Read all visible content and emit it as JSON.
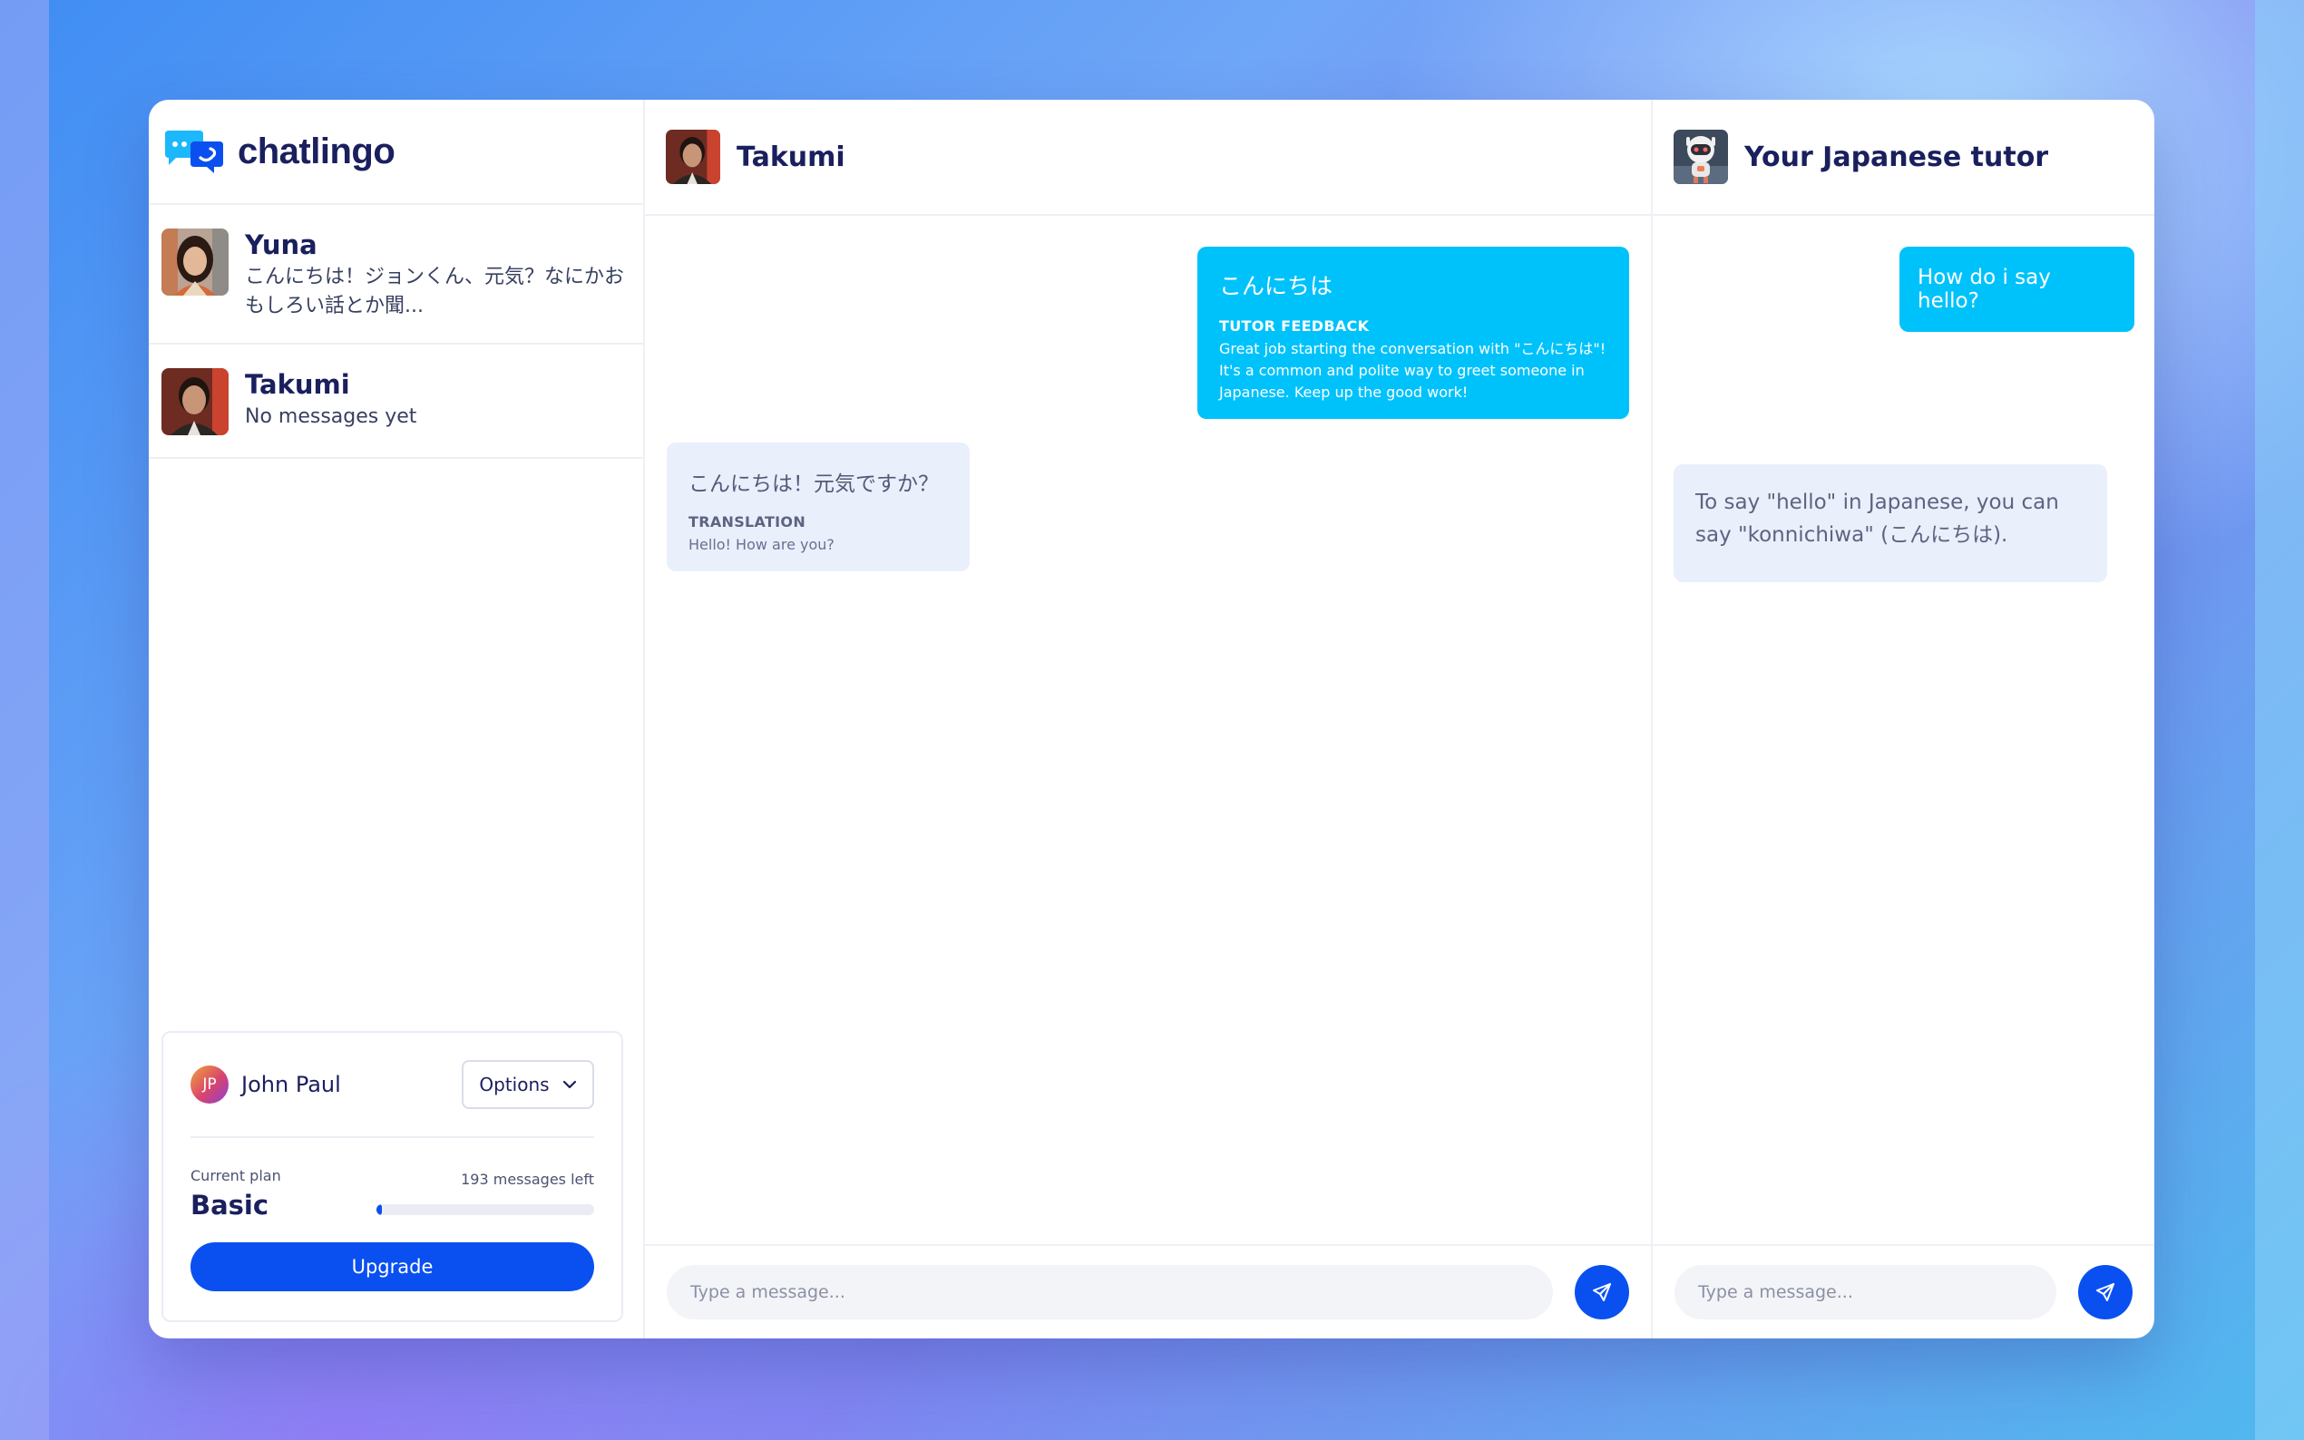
{
  "app": {
    "name": "chatlingo"
  },
  "contacts": [
    {
      "name": "Yuna",
      "preview": "こんにちは！ジョンくん、元気？なにかおもしろい話とか聞..."
    },
    {
      "name": "Takumi",
      "preview": "No messages yet"
    }
  ],
  "account": {
    "initials": "JP",
    "user_name": "John Paul",
    "options_label": "Options",
    "plan_label": "Current plan",
    "plan_name": "Basic",
    "messages_left": "193 messages left",
    "usage_fraction": 0.02,
    "upgrade_label": "Upgrade"
  },
  "chat": {
    "title": "Takumi",
    "messages": [
      {
        "text": "こんにちは",
        "feedback_label": "TUTOR FEEDBACK",
        "feedback_text": "Great job starting the conversation with \"こんにちは\"! It's a common and polite way to greet someone in Japanese. Keep up the good work!"
      },
      {
        "text": "こんにちは！元気ですか？",
        "translation_label": "TRANSLATION",
        "translation_text": "Hello! How are you?"
      }
    ],
    "input_placeholder": "Type a message..."
  },
  "tutor": {
    "title": "Your Japanese tutor",
    "messages": [
      {
        "text": "How do i say hello?"
      },
      {
        "text": "To say \"hello\" in Japanese, you can say \"konnichiwa\" (こんにちは)."
      }
    ],
    "input_placeholder": "Type a message..."
  },
  "colors": {
    "primary": "#0a50f0",
    "outgoing_bubble": "#00c2fb",
    "incoming_bubble": "#eaeffc",
    "heading": "#1a1f5e"
  },
  "icons": {
    "logo": "chat-bubbles-logo-icon",
    "dropdown": "chevron-down-icon",
    "send": "send-icon"
  }
}
